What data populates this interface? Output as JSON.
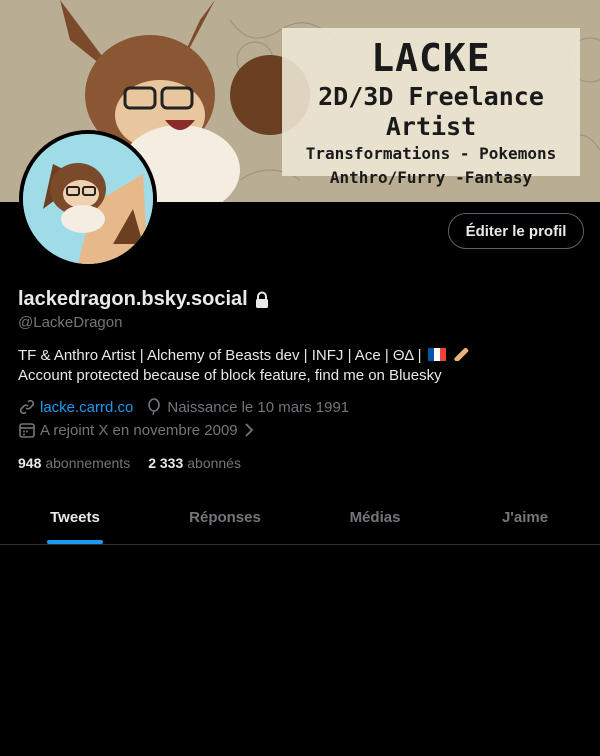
{
  "banner": {
    "title": "LACKE",
    "subtitle": "2D/3D Freelance Artist",
    "line1": "Transformations - Pokemons",
    "line2": "Anthro/Furry -Fantasy"
  },
  "profile": {
    "edit_label": "Éditer le profil",
    "display_name": "lackedragon.bsky.social",
    "handle": "@LackeDragon",
    "bio_line1": "TF & Anthro Artist | Alchemy of Beasts dev | INFJ | Ace | ΘΔ | ",
    "bio_line2": "Account protected because of block feature, find me on Bluesky",
    "link": "lacke.carrd.co",
    "birthday": "Naissance le 10 mars 1991",
    "joined": "A rejoint X en novembre 2009"
  },
  "counts": {
    "following_num": "948",
    "following_label": "abonnements",
    "followers_num": "2 333",
    "followers_label": "abonnés"
  },
  "tabs": {
    "tweets": "Tweets",
    "replies": "Réponses",
    "media": "Médias",
    "likes": "J'aime"
  },
  "colors": {
    "accent": "#1d9bf0",
    "muted": "#71767b",
    "background": "#000000"
  }
}
